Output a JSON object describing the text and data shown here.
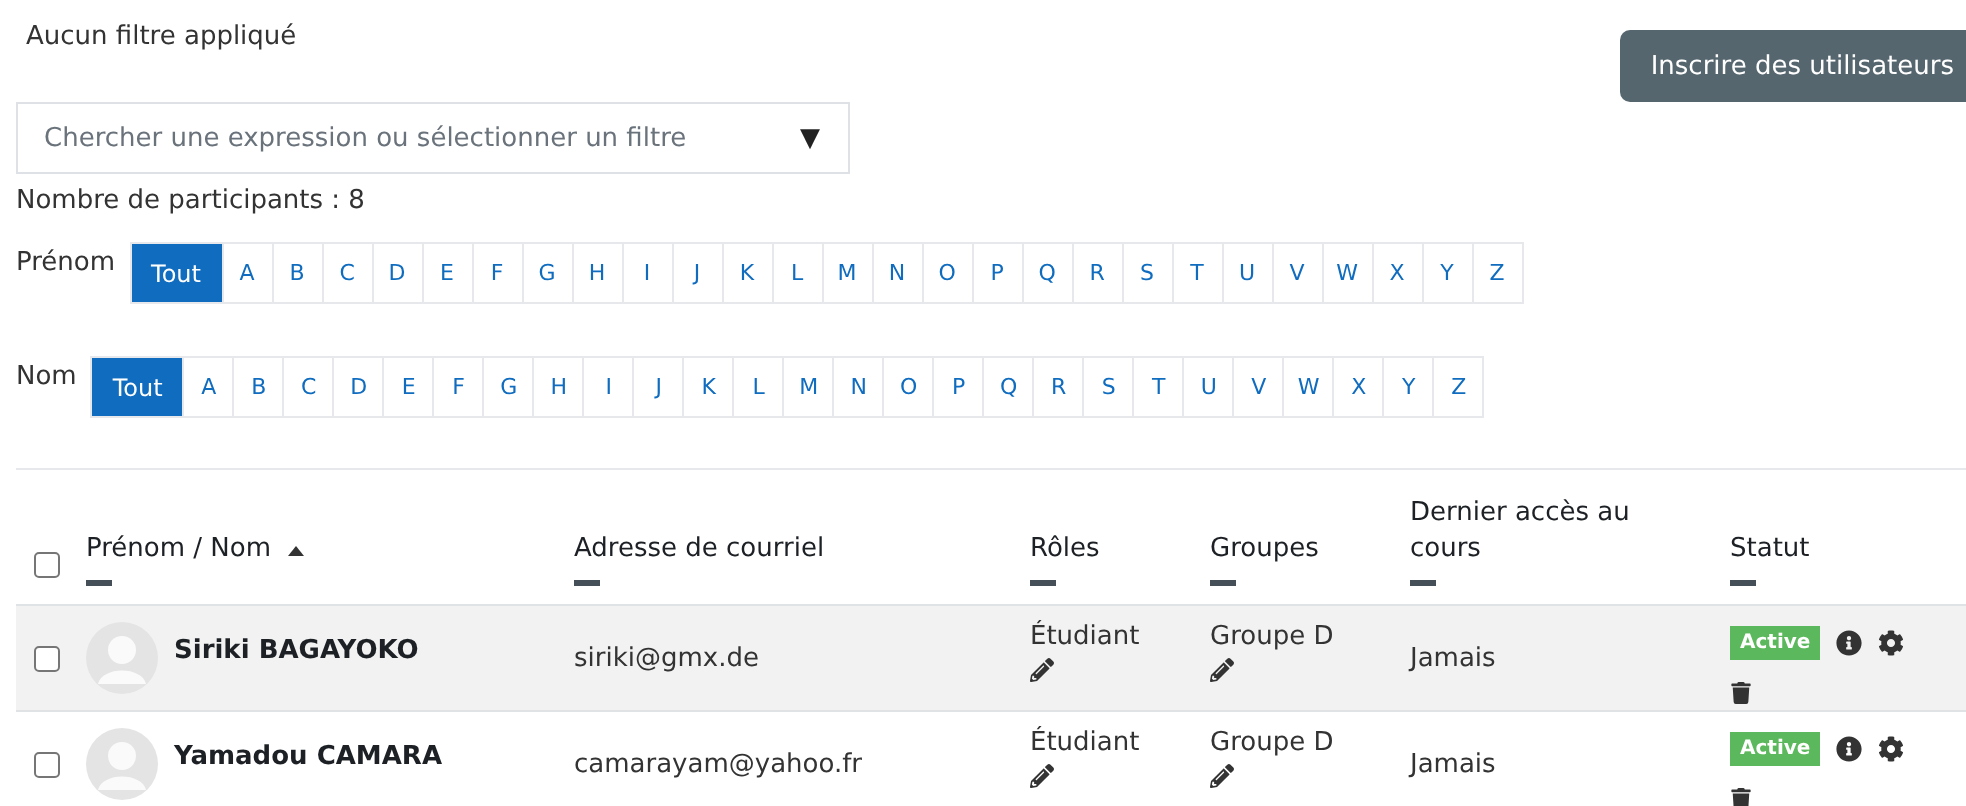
{
  "filter_status": "Aucun filtre appliqué",
  "enrol_button": "Inscrire des utilisateurs",
  "search": {
    "placeholder": "Chercher une expression ou sélectionner un filtre",
    "arrow": "▼"
  },
  "participant_count": "Nombre de participants : 8",
  "initials_bars": [
    {
      "label": "Prénom",
      "letters": [
        {
          "text": "Tout",
          "selected": true
        },
        {
          "text": "A",
          "selected": false
        },
        {
          "text": "B",
          "selected": false
        },
        {
          "text": "C",
          "selected": false
        },
        {
          "text": "D",
          "selected": false
        },
        {
          "text": "E",
          "selected": false
        },
        {
          "text": "F",
          "selected": false
        },
        {
          "text": "G",
          "selected": false
        },
        {
          "text": "H",
          "selected": false
        },
        {
          "text": "I",
          "selected": false
        },
        {
          "text": "J",
          "selected": false
        },
        {
          "text": "K",
          "selected": false
        },
        {
          "text": "L",
          "selected": false
        },
        {
          "text": "M",
          "selected": false
        },
        {
          "text": "N",
          "selected": false
        },
        {
          "text": "O",
          "selected": false
        },
        {
          "text": "P",
          "selected": false
        },
        {
          "text": "Q",
          "selected": false
        },
        {
          "text": "R",
          "selected": false
        },
        {
          "text": "S",
          "selected": false
        },
        {
          "text": "T",
          "selected": false
        },
        {
          "text": "U",
          "selected": false
        },
        {
          "text": "V",
          "selected": false
        },
        {
          "text": "W",
          "selected": false
        },
        {
          "text": "X",
          "selected": false
        },
        {
          "text": "Y",
          "selected": false
        },
        {
          "text": "Z",
          "selected": false
        }
      ]
    },
    {
      "label": "Nom",
      "letters": [
        {
          "text": "Tout",
          "selected": true
        },
        {
          "text": "A",
          "selected": false
        },
        {
          "text": "B",
          "selected": false
        },
        {
          "text": "C",
          "selected": false
        },
        {
          "text": "D",
          "selected": false
        },
        {
          "text": "E",
          "selected": false
        },
        {
          "text": "F",
          "selected": false
        },
        {
          "text": "G",
          "selected": false
        },
        {
          "text": "H",
          "selected": false
        },
        {
          "text": "I",
          "selected": false
        },
        {
          "text": "J",
          "selected": false
        },
        {
          "text": "K",
          "selected": false
        },
        {
          "text": "L",
          "selected": false
        },
        {
          "text": "M",
          "selected": false
        },
        {
          "text": "N",
          "selected": false
        },
        {
          "text": "O",
          "selected": false
        },
        {
          "text": "P",
          "selected": false
        },
        {
          "text": "Q",
          "selected": false
        },
        {
          "text": "R",
          "selected": false
        },
        {
          "text": "S",
          "selected": false
        },
        {
          "text": "T",
          "selected": false
        },
        {
          "text": "U",
          "selected": false
        },
        {
          "text": "V",
          "selected": false
        },
        {
          "text": "W",
          "selected": false
        },
        {
          "text": "X",
          "selected": false
        },
        {
          "text": "Y",
          "selected": false
        },
        {
          "text": "Z",
          "selected": false
        }
      ]
    }
  ],
  "table": {
    "select_all": {
      "checked": false
    },
    "columns": [
      {
        "label": "Prénom / Nom",
        "sorted": true
      },
      {
        "label": "Adresse de courriel",
        "sorted": false
      },
      {
        "label": "Rôles",
        "sorted": false
      },
      {
        "label": "Groupes",
        "sorted": false
      },
      {
        "label": "Dernier accès au cours",
        "sorted": false
      },
      {
        "label": "Statut",
        "sorted": false
      }
    ],
    "rows": [
      {
        "checked": false,
        "hovered": true,
        "name": "Siriki BAGAYOKO",
        "email": "siriki@gmx.de",
        "role": "Étudiant",
        "group": "Groupe D",
        "last_access": "Jamais",
        "status": "Active"
      },
      {
        "checked": false,
        "hovered": false,
        "name": "Yamadou CAMARA",
        "email": "camarayam@yahoo.fr",
        "role": "Étudiant",
        "group": "Groupe D",
        "last_access": "Jamais",
        "status": "Active"
      }
    ]
  }
}
